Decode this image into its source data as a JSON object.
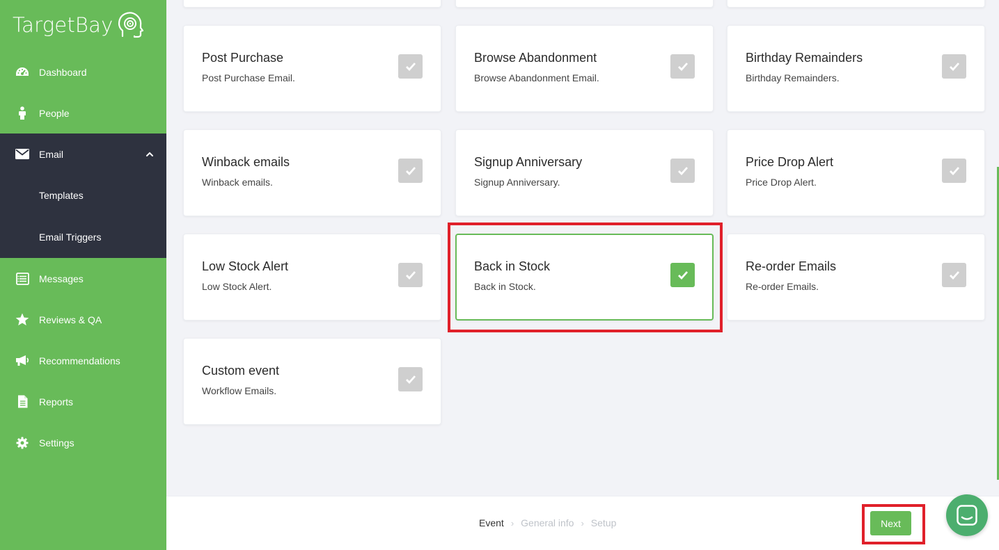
{
  "sidebar": {
    "logo": "TargetBay",
    "items": [
      {
        "label": "Dashboard",
        "icon": "dashboard-icon"
      },
      {
        "label": "People",
        "icon": "person-icon"
      },
      {
        "label": "Email",
        "icon": "envelope-icon",
        "expanded": true
      },
      {
        "label": "Messages",
        "icon": "messages-icon"
      },
      {
        "label": "Reviews & QA",
        "icon": "star-icon"
      },
      {
        "label": "Recommendations",
        "icon": "megaphone-icon"
      },
      {
        "label": "Reports",
        "icon": "document-icon"
      },
      {
        "label": "Settings",
        "icon": "gear-icon"
      }
    ],
    "email_subitems": [
      {
        "label": "Templates"
      },
      {
        "label": "Email Triggers"
      }
    ]
  },
  "cards": [
    {
      "title": "Post Purchase",
      "desc": "Post Purchase Email.",
      "checked": false
    },
    {
      "title": "Browse Abandonment",
      "desc": "Browse Abandonment Email.",
      "checked": false
    },
    {
      "title": "Birthday Remainders",
      "desc": "Birthday Remainders.",
      "checked": false
    },
    {
      "title": "Winback emails",
      "desc": "Winback emails.",
      "checked": false
    },
    {
      "title": "Signup Anniversary",
      "desc": "Signup Anniversary.",
      "checked": false
    },
    {
      "title": "Price Drop Alert",
      "desc": "Price Drop Alert.",
      "checked": false
    },
    {
      "title": "Low Stock Alert",
      "desc": "Low Stock Alert.",
      "checked": false
    },
    {
      "title": "Back in Stock",
      "desc": "Back in Stock.",
      "checked": true
    },
    {
      "title": "Re-order Emails",
      "desc": "Re-order Emails.",
      "checked": false
    },
    {
      "title": "Custom event",
      "desc": "Workflow Emails.",
      "checked": false
    }
  ],
  "footer": {
    "steps": [
      "Event",
      "General info",
      "Setup"
    ],
    "current_step": "Event",
    "next_label": "Next"
  },
  "colors": {
    "brand_green": "#68bb59",
    "sidebar_dark": "#2e323f",
    "highlight_red": "#e0202a"
  }
}
